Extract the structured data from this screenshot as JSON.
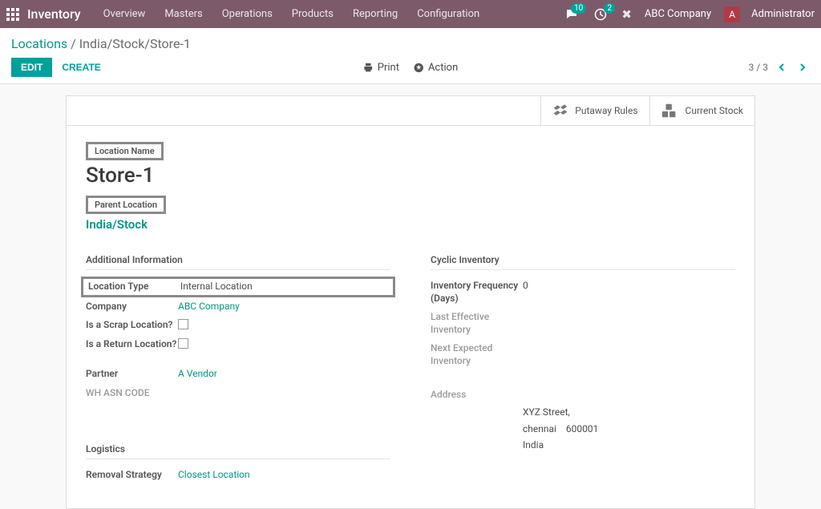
{
  "topbar": {
    "app_name": "Inventory",
    "menu": [
      "Overview",
      "Masters",
      "Operations",
      "Products",
      "Reporting",
      "Configuration"
    ],
    "messages_badge": "10",
    "activities_badge": "2",
    "company": "ABC Company",
    "user_initial": "A",
    "user_name": "Administrator"
  },
  "breadcrumb": {
    "root": "Locations",
    "current": "India/Stock/Store-1"
  },
  "buttons": {
    "edit": "EDIT",
    "create": "CREATE",
    "print": "Print",
    "action": "Action"
  },
  "pager": {
    "text": "3 / 3"
  },
  "statbuttons": {
    "putaway": "Putaway Rules",
    "stock": "Current Stock"
  },
  "form": {
    "location_name_label": "Location Name",
    "location_name": "Store-1",
    "parent_label": "Parent Location",
    "parent_value": "India/Stock",
    "additional_header": "Additional Information",
    "fields": {
      "location_type_label": "Location Type",
      "location_type_value": "Internal Location",
      "company_label": "Company",
      "company_value": "ABC Company",
      "scrap_label": "Is a Scrap Location?",
      "return_label": "Is a Return Location?",
      "partner_label": "Partner",
      "partner_value": "A Vendor",
      "asn_label": "WH ASN CODE"
    },
    "cyclic_header": "Cyclic Inventory",
    "cyclic": {
      "freq_label": "Inventory Frequency (Days)",
      "freq_value": "0",
      "last_label": "Last Effective Inventory",
      "next_label": "Next Expected Inventory",
      "address_label": "Address",
      "addr_line1": "XYZ Street,",
      "addr_city": "chennai",
      "addr_zip": "600001",
      "addr_country": "India"
    },
    "logistics_header": "Logistics",
    "removal_label": "Removal Strategy",
    "removal_value": "Closest Location"
  }
}
